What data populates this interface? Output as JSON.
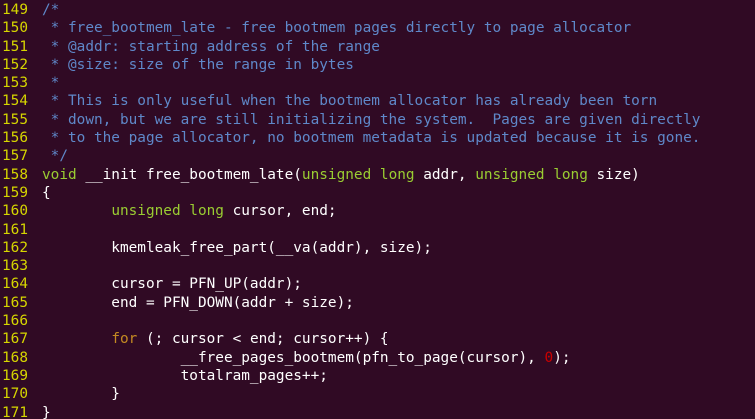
{
  "theme": {
    "background": "#300a24",
    "line_number_color": "#d6d600",
    "comment_color": "#5f88c9",
    "type_color": "#9acd32",
    "keyword_color": "#c48a22",
    "number_color": "#cc0000",
    "text_color": "#ffffff"
  },
  "lines": [
    {
      "num": "149",
      "tokens": [
        {
          "t": "/*",
          "k": "comment"
        }
      ]
    },
    {
      "num": "150",
      "tokens": [
        {
          "t": " * free_bootmem_late - free bootmem pages directly to page allocator",
          "k": "comment"
        }
      ]
    },
    {
      "num": "151",
      "tokens": [
        {
          "t": " * @addr: starting address of the range",
          "k": "comment"
        }
      ]
    },
    {
      "num": "152",
      "tokens": [
        {
          "t": " * @size: size of the range in bytes",
          "k": "comment"
        }
      ]
    },
    {
      "num": "153",
      "tokens": [
        {
          "t": " *",
          "k": "comment"
        }
      ]
    },
    {
      "num": "154",
      "tokens": [
        {
          "t": " * This is only useful when the bootmem allocator has already been torn",
          "k": "comment"
        }
      ]
    },
    {
      "num": "155",
      "tokens": [
        {
          "t": " * down, but we are still initializing the system.  Pages are given directly",
          "k": "comment"
        }
      ]
    },
    {
      "num": "156",
      "tokens": [
        {
          "t": " * to the page allocator, no bootmem metadata is updated because it is gone.",
          "k": "comment"
        }
      ]
    },
    {
      "num": "157",
      "tokens": [
        {
          "t": " */",
          "k": "comment"
        }
      ]
    },
    {
      "num": "158",
      "tokens": [
        {
          "t": "void",
          "k": "type"
        },
        {
          "t": " __init free_bootmem_late(",
          "k": "plain"
        },
        {
          "t": "unsigned",
          "k": "type"
        },
        {
          "t": " ",
          "k": "plain"
        },
        {
          "t": "long",
          "k": "type"
        },
        {
          "t": " addr, ",
          "k": "plain"
        },
        {
          "t": "unsigned",
          "k": "type"
        },
        {
          "t": " ",
          "k": "plain"
        },
        {
          "t": "long",
          "k": "type"
        },
        {
          "t": " size)",
          "k": "plain"
        }
      ]
    },
    {
      "num": "159",
      "tokens": [
        {
          "t": "{",
          "k": "plain"
        }
      ]
    },
    {
      "num": "160",
      "tokens": [
        {
          "t": "        ",
          "k": "plain"
        },
        {
          "t": "unsigned",
          "k": "type"
        },
        {
          "t": " ",
          "k": "plain"
        },
        {
          "t": "long",
          "k": "type"
        },
        {
          "t": " cursor, end;",
          "k": "plain"
        }
      ]
    },
    {
      "num": "161",
      "tokens": []
    },
    {
      "num": "162",
      "tokens": [
        {
          "t": "        kmemleak_free_part(__va(addr), size);",
          "k": "plain"
        }
      ]
    },
    {
      "num": "163",
      "tokens": []
    },
    {
      "num": "164",
      "tokens": [
        {
          "t": "        cursor = PFN_UP(addr);",
          "k": "plain"
        }
      ]
    },
    {
      "num": "165",
      "tokens": [
        {
          "t": "        end = PFN_DOWN(addr + size);",
          "k": "plain"
        }
      ]
    },
    {
      "num": "166",
      "tokens": []
    },
    {
      "num": "167",
      "tokens": [
        {
          "t": "        ",
          "k": "plain"
        },
        {
          "t": "for",
          "k": "kw"
        },
        {
          "t": " (; cursor < end; cursor++) {",
          "k": "plain"
        }
      ]
    },
    {
      "num": "168",
      "tokens": [
        {
          "t": "                __free_pages_bootmem(pfn_to_page(cursor), ",
          "k": "plain"
        },
        {
          "t": "0",
          "k": "num"
        },
        {
          "t": ");",
          "k": "plain"
        }
      ]
    },
    {
      "num": "169",
      "tokens": [
        {
          "t": "                totalram_pages++;",
          "k": "plain"
        }
      ]
    },
    {
      "num": "170",
      "tokens": [
        {
          "t": "        }",
          "k": "plain"
        }
      ]
    },
    {
      "num": "171",
      "tokens": [
        {
          "t": "}",
          "k": "plain"
        }
      ]
    }
  ]
}
